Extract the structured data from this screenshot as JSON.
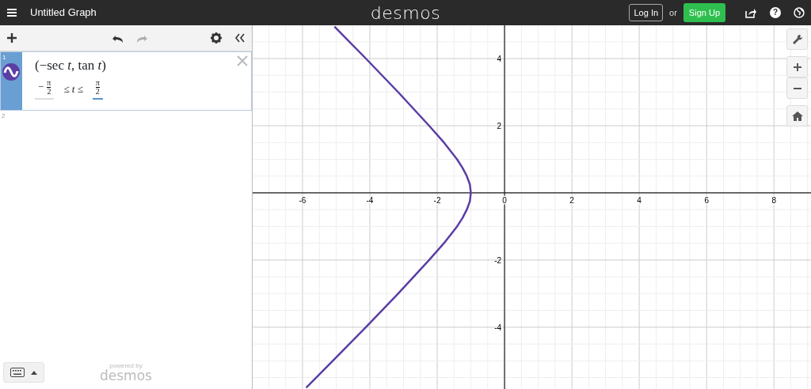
{
  "header": {
    "title": "Untitled Graph",
    "logo": "desmos",
    "login": "Log In",
    "or": "or",
    "signup": "Sign Up",
    "help": "?"
  },
  "toolbar": {
    "undo_disabled": false,
    "redo_disabled": true
  },
  "expressions": [
    {
      "number": "1",
      "selected": true,
      "math": "(−sec *t*, tan *t*)",
      "domain": {
        "lower": {
          "sign": "−",
          "numerator": "π",
          "denominator": "2",
          "focused": false
        },
        "operator": "≤ *t* ≤",
        "upper": {
          "numerator": "π",
          "denominator": "2",
          "focused": true
        }
      }
    },
    {
      "number": "2",
      "selected": false
    }
  ],
  "footer": {
    "powered_by": "powered by",
    "logo": "desmos"
  },
  "graph": {
    "chart_data": {
      "type": "line",
      "x": [
        -5.89,
        -5.1,
        -4.12,
        -3.16,
        -2.24,
        -1.8,
        -1.41,
        -1.25,
        -1.12,
        -1.03,
        -1,
        -1.03,
        -1.12,
        -1.25,
        -1.41,
        -1.8,
        -2.24,
        -3.16,
        -4.12,
        -5.05
      ],
      "series": [
        {
          "color": "#5b3ea4",
          "values": [
            -5.8,
            -5,
            -4,
            -3,
            -2,
            -1.5,
            -1,
            -0.75,
            -0.5,
            -0.25,
            0,
            0.25,
            0.5,
            0.75,
            1,
            1.5,
            2,
            3,
            4,
            4.95
          ]
        }
      ],
      "xlim": [
        -7.48,
        9.1
      ],
      "ylim": [
        -5.84,
        4.99
      ],
      "xticks": [
        -6,
        -4,
        -2,
        0,
        2,
        4,
        6,
        8
      ],
      "yticks": [
        -4,
        -2,
        2,
        4
      ],
      "grid": true
    }
  }
}
